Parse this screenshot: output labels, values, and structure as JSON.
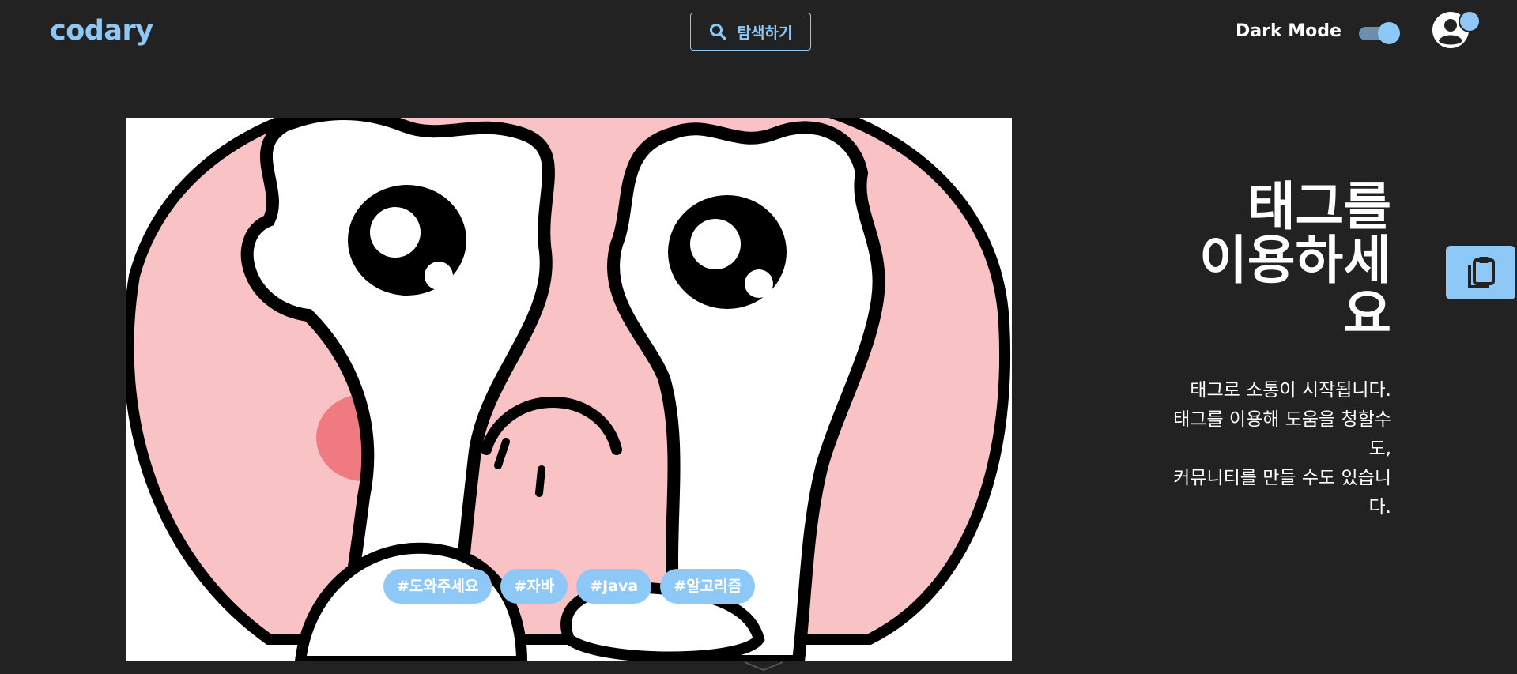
{
  "header": {
    "logo": "codary",
    "search_label": "탐색하기",
    "dark_mode_label": "Dark Mode",
    "dark_mode_enabled": true
  },
  "hero": {
    "tags": [
      "#도와주세요",
      "#자바",
      "#Java",
      "#알고리즘"
    ]
  },
  "promo": {
    "headline_lines": [
      "태그를",
      "이용하세",
      "요"
    ],
    "description_lines": [
      "태그로 소통이 시작됩니다.",
      "태그를 이용해 도움을 청할수",
      "도,",
      "커뮤니티를 만들 수도 있습니",
      "다."
    ]
  },
  "colors": {
    "background": "#222222",
    "accent": "#8ec8f7",
    "text": "#ffffff"
  },
  "icons": [
    "search-icon",
    "user-icon",
    "notification-dot-icon",
    "clipboard-icon",
    "chevron-down-icon"
  ]
}
